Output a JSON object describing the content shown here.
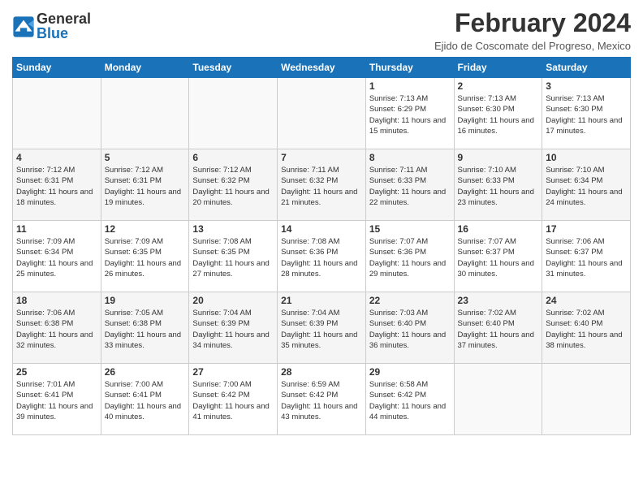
{
  "header": {
    "logo_line1": "General",
    "logo_line2": "Blue",
    "month_title": "February 2024",
    "location": "Ejido de Coscomate del Progreso, Mexico"
  },
  "days_of_week": [
    "Sunday",
    "Monday",
    "Tuesday",
    "Wednesday",
    "Thursday",
    "Friday",
    "Saturday"
  ],
  "weeks": [
    [
      {
        "day": "",
        "info": ""
      },
      {
        "day": "",
        "info": ""
      },
      {
        "day": "",
        "info": ""
      },
      {
        "day": "",
        "info": ""
      },
      {
        "day": "1",
        "info": "Sunrise: 7:13 AM\nSunset: 6:29 PM\nDaylight: 11 hours and 15 minutes."
      },
      {
        "day": "2",
        "info": "Sunrise: 7:13 AM\nSunset: 6:30 PM\nDaylight: 11 hours and 16 minutes."
      },
      {
        "day": "3",
        "info": "Sunrise: 7:13 AM\nSunset: 6:30 PM\nDaylight: 11 hours and 17 minutes."
      }
    ],
    [
      {
        "day": "4",
        "info": "Sunrise: 7:12 AM\nSunset: 6:31 PM\nDaylight: 11 hours and 18 minutes."
      },
      {
        "day": "5",
        "info": "Sunrise: 7:12 AM\nSunset: 6:31 PM\nDaylight: 11 hours and 19 minutes."
      },
      {
        "day": "6",
        "info": "Sunrise: 7:12 AM\nSunset: 6:32 PM\nDaylight: 11 hours and 20 minutes."
      },
      {
        "day": "7",
        "info": "Sunrise: 7:11 AM\nSunset: 6:32 PM\nDaylight: 11 hours and 21 minutes."
      },
      {
        "day": "8",
        "info": "Sunrise: 7:11 AM\nSunset: 6:33 PM\nDaylight: 11 hours and 22 minutes."
      },
      {
        "day": "9",
        "info": "Sunrise: 7:10 AM\nSunset: 6:33 PM\nDaylight: 11 hours and 23 minutes."
      },
      {
        "day": "10",
        "info": "Sunrise: 7:10 AM\nSunset: 6:34 PM\nDaylight: 11 hours and 24 minutes."
      }
    ],
    [
      {
        "day": "11",
        "info": "Sunrise: 7:09 AM\nSunset: 6:34 PM\nDaylight: 11 hours and 25 minutes."
      },
      {
        "day": "12",
        "info": "Sunrise: 7:09 AM\nSunset: 6:35 PM\nDaylight: 11 hours and 26 minutes."
      },
      {
        "day": "13",
        "info": "Sunrise: 7:08 AM\nSunset: 6:35 PM\nDaylight: 11 hours and 27 minutes."
      },
      {
        "day": "14",
        "info": "Sunrise: 7:08 AM\nSunset: 6:36 PM\nDaylight: 11 hours and 28 minutes."
      },
      {
        "day": "15",
        "info": "Sunrise: 7:07 AM\nSunset: 6:36 PM\nDaylight: 11 hours and 29 minutes."
      },
      {
        "day": "16",
        "info": "Sunrise: 7:07 AM\nSunset: 6:37 PM\nDaylight: 11 hours and 30 minutes."
      },
      {
        "day": "17",
        "info": "Sunrise: 7:06 AM\nSunset: 6:37 PM\nDaylight: 11 hours and 31 minutes."
      }
    ],
    [
      {
        "day": "18",
        "info": "Sunrise: 7:06 AM\nSunset: 6:38 PM\nDaylight: 11 hours and 32 minutes."
      },
      {
        "day": "19",
        "info": "Sunrise: 7:05 AM\nSunset: 6:38 PM\nDaylight: 11 hours and 33 minutes."
      },
      {
        "day": "20",
        "info": "Sunrise: 7:04 AM\nSunset: 6:39 PM\nDaylight: 11 hours and 34 minutes."
      },
      {
        "day": "21",
        "info": "Sunrise: 7:04 AM\nSunset: 6:39 PM\nDaylight: 11 hours and 35 minutes."
      },
      {
        "day": "22",
        "info": "Sunrise: 7:03 AM\nSunset: 6:40 PM\nDaylight: 11 hours and 36 minutes."
      },
      {
        "day": "23",
        "info": "Sunrise: 7:02 AM\nSunset: 6:40 PM\nDaylight: 11 hours and 37 minutes."
      },
      {
        "day": "24",
        "info": "Sunrise: 7:02 AM\nSunset: 6:40 PM\nDaylight: 11 hours and 38 minutes."
      }
    ],
    [
      {
        "day": "25",
        "info": "Sunrise: 7:01 AM\nSunset: 6:41 PM\nDaylight: 11 hours and 39 minutes."
      },
      {
        "day": "26",
        "info": "Sunrise: 7:00 AM\nSunset: 6:41 PM\nDaylight: 11 hours and 40 minutes."
      },
      {
        "day": "27",
        "info": "Sunrise: 7:00 AM\nSunset: 6:42 PM\nDaylight: 11 hours and 41 minutes."
      },
      {
        "day": "28",
        "info": "Sunrise: 6:59 AM\nSunset: 6:42 PM\nDaylight: 11 hours and 43 minutes."
      },
      {
        "day": "29",
        "info": "Sunrise: 6:58 AM\nSunset: 6:42 PM\nDaylight: 11 hours and 44 minutes."
      },
      {
        "day": "",
        "info": ""
      },
      {
        "day": "",
        "info": ""
      }
    ]
  ]
}
